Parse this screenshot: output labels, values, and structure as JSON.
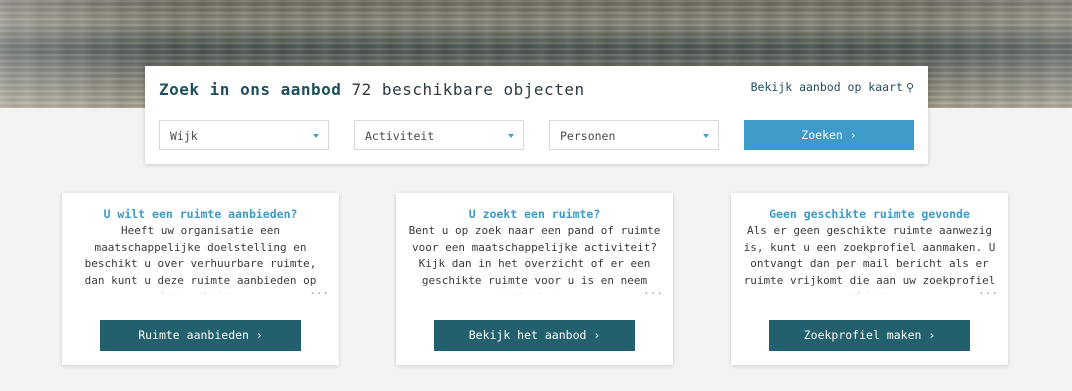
{
  "search": {
    "title_strong": "Zoek in ons aanbod",
    "title_count": "72 beschikbare objecten",
    "map_link": "Bekijk aanbod op kaart",
    "filters": [
      {
        "label": "Wijk"
      },
      {
        "label": "Activiteit"
      },
      {
        "label": "Personen"
      }
    ],
    "submit_label": "Zoeken ›"
  },
  "cards": [
    {
      "title": "U wilt een ruimte aanbieden?",
      "body": "Heeft uw organisatie een maatschappelijke doelstelling en beschikt u over verhuurbare ruimte, dan kunt u deze ruimte aanbieden op deze website.",
      "ellipsis": "...",
      "button": "Ruimte aanbieden ›"
    },
    {
      "title": "U zoekt een ruimte?",
      "body": "Bent u op zoek naar een pand of ruimte voor een maatschappelijke activiteit? Kijk dan in het overzicht of er een geschikte ruimte voor u is en neem contact op.",
      "ellipsis": "...",
      "button": "Bekijk het aanbod ›"
    },
    {
      "title": "Geen geschikte ruimte gevonde",
      "body": "Als er geen geschikte ruimte aanwezig is, kunt u een zoekprofiel aanmaken. U ontvangt dan per mail bericht als er ruimte vrijkomt die aan uw zoekprofiel voldoet.",
      "ellipsis": "...",
      "button": "Zoekprofiel maken ›"
    }
  ]
}
